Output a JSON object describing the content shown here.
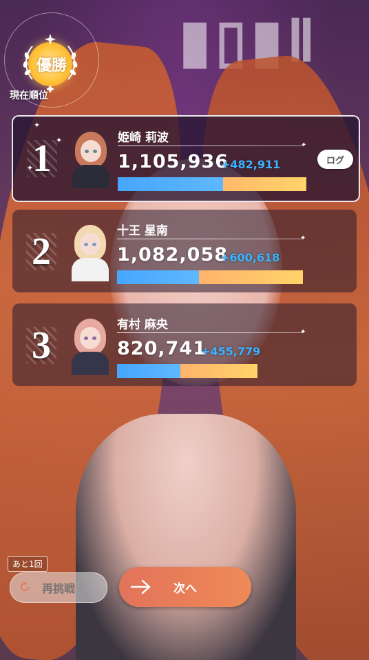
{
  "badge": {
    "title": "優勝",
    "caption": "現在順位"
  },
  "ranking": [
    {
      "rank": "1",
      "name": "姫崎 莉波",
      "score": "1,105,936",
      "gain": "+482,911",
      "share": 0.56,
      "log_label": "ログ",
      "hair_color": "#c97a5c",
      "cloth_color": "#2b2b3a"
    },
    {
      "rank": "2",
      "name": "十王 星南",
      "score": "1,082,058",
      "gain": "+600,618",
      "share": 0.44,
      "hair_color": "#f2d9b0",
      "cloth_color": "#f2f2f2"
    },
    {
      "rank": "3",
      "name": "有村 麻央",
      "score": "820,741",
      "gain": "+455,779",
      "share": 0.45,
      "hair_color": "#e8a9a0",
      "cloth_color": "#35364a"
    }
  ],
  "controls": {
    "remaining": "あと1回",
    "retry_label": "再挑戦",
    "next_label": "次へ"
  },
  "colors": {
    "bar_blue": "#46a6ff",
    "bar_orange": "#ff9a6b",
    "bar_yellow": "#ffd36a",
    "gain_blue": "#3ab4ff",
    "next_button": "#e97e58"
  }
}
